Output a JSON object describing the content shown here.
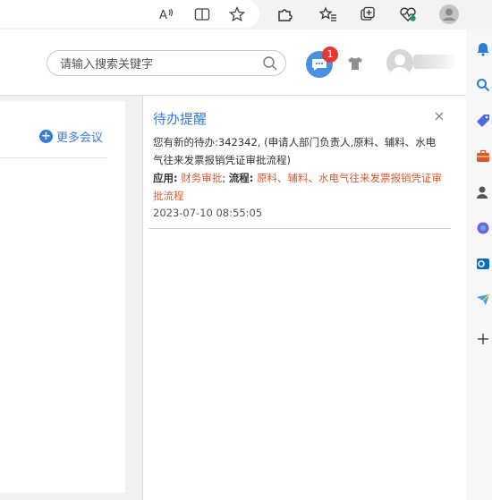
{
  "browser": {
    "toolbar_icons": [
      "read-aloud-icon",
      "immersive-reader-icon",
      "favorite-star-icon",
      "extensions-icon",
      "favorites-icon",
      "collections-icon",
      "browser-essentials-icon",
      "profile-icon"
    ],
    "sidebar_icons": [
      "notifications-icon",
      "search-icon",
      "tag-icon",
      "briefcase-icon",
      "user-icon",
      "copilot-icon",
      "outlook-icon",
      "send-icon",
      "add-icon"
    ]
  },
  "header": {
    "search_placeholder": "请输入搜索关键字",
    "message_badge": "1"
  },
  "left_panel": {
    "more_meetings": "更多会议"
  },
  "notification": {
    "title": "待办提醒",
    "close": "×",
    "message": "您有新的待办:342342, (申请人部门负责人,原料、辅料、水电气往来发票报销凭证审批流程)",
    "app_label": "应用:",
    "app_value": "财务审批",
    "separator": ";",
    "flow_label": "流程:",
    "flow_value": "原料、辅料、水电气往来发票报销凭证审批流程",
    "time": "2023-07-10 08:55:05"
  },
  "colors": {
    "accent": "#3a7bd5",
    "badge": "#e53935",
    "link_red": "#d9582b"
  }
}
